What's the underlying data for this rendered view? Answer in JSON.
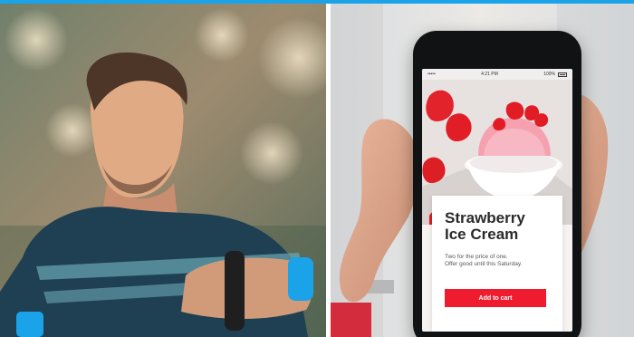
{
  "status_bar": {
    "signal": "••••• ",
    "time": "4:21 PM",
    "battery": "100%"
  },
  "promo": {
    "title_line1": "Strawberry",
    "title_line2": "Ice Cream",
    "text": "Two for the price of one.\nOffer good until this Saturday.",
    "button_label": "Add to cart"
  },
  "colors": {
    "accent": "#1aa3e8",
    "button": "#ee1c2e"
  }
}
